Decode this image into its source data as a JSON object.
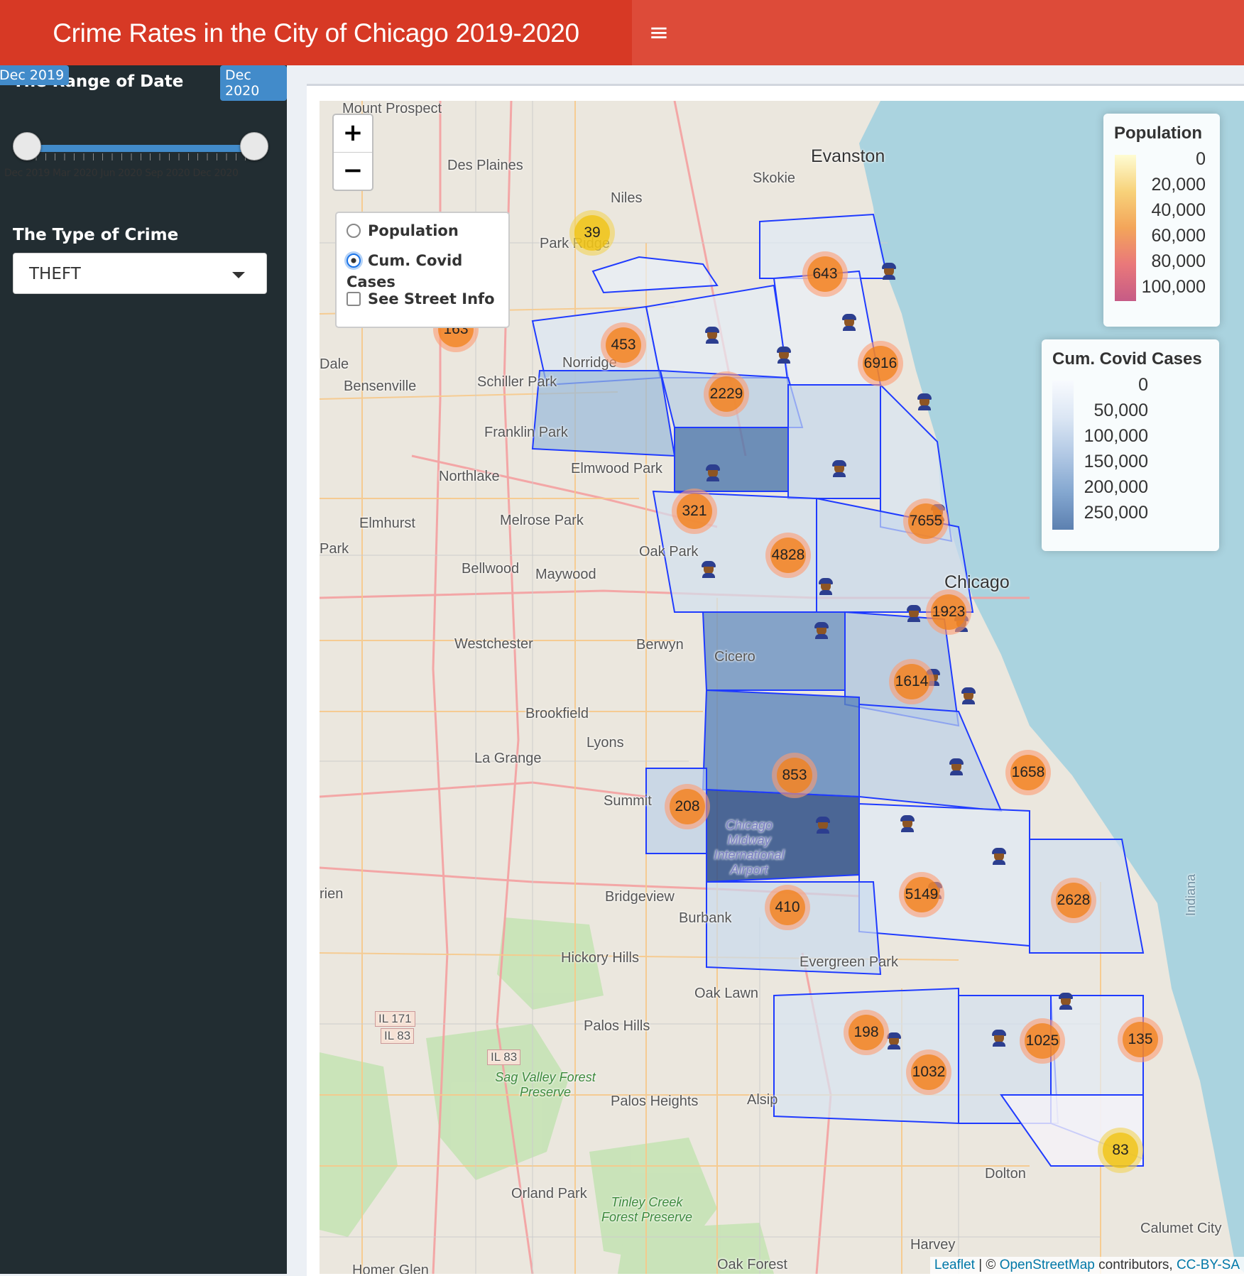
{
  "header": {
    "title": "Crime Rates in the City of Chicago 2019-2020",
    "menu_icon": "≡"
  },
  "sidebar": {
    "date_range": {
      "label": "The Range of Date",
      "from": "Dec 2019",
      "to": "Dec 2020",
      "tick_labels": "Dec 2019  Mar 2020  Jun 2020  Sep 2020  Dec 2020"
    },
    "crime_type": {
      "label": "The Type of Crime",
      "selected": "THEFT"
    }
  },
  "map": {
    "zoom_in": "+",
    "zoom_out": "−",
    "layers": {
      "population": "Population",
      "covid": "Cum. Covid Cases",
      "street": "See Street Info",
      "selected": "Cum. Covid Cases"
    },
    "legend_population": {
      "title": "Population",
      "ticks": [
        "0",
        "20,000",
        "40,000",
        "60,000",
        "80,000",
        "100,000"
      ]
    },
    "legend_covid": {
      "title": "Cum. Covid Cases",
      "ticks": [
        "0",
        "50,000",
        "100,000",
        "150,000",
        "200,000",
        "250,000"
      ]
    },
    "place_labels": {
      "mount_prospect": "Mount Prospect",
      "evanston": "Evanston",
      "skokie": "Skokie",
      "des_plaines": "Des Plaines",
      "niles": "Niles",
      "park_ridge": "Park Ridge",
      "norridge": "Norridge",
      "bensenville": "Bensenville",
      "schiller_park": "Schiller Park",
      "franklin_park": "Franklin Park",
      "elmwood_park": "Elmwood Park",
      "northlake": "Northlake",
      "elmhurst": "Elmhurst",
      "melrose_park": "Melrose Park",
      "oak_park": "Oak Park",
      "bellwood": "Bellwood",
      "maywood": "Maywood",
      "chicago": "Chicago",
      "westchester": "Westchester",
      "berwyn": "Berwyn",
      "cicero": "Cicero",
      "brookfield": "Brookfield",
      "lyons": "Lyons",
      "la_grange": "La Grange",
      "summit": "Summit",
      "bridgeview": "Bridgeview",
      "burbank": "Burbank",
      "hickory_hills": "Hickory Hills",
      "evergreen_park": "Evergreen Park",
      "oak_lawn": "Oak Lawn",
      "palos_hills": "Palos Hills",
      "palos_heights": "Palos Heights",
      "alsip": "Alsip",
      "orland_park": "Orland Park",
      "dolton": "Dolton",
      "harvey": "Harvey",
      "calumet_city": "Calumet City",
      "oak_forest": "Oak Forest",
      "homer_glen": "Homer Glen",
      "sag_valley": "Sag Valley Forest Preserve",
      "tinley_creek": "Tinley Creek Forest Preserve",
      "indiana": "Indiana",
      "midway": "Chicago Midway International Airport",
      "dale": "Dale",
      "park": "Park",
      "rien": "rien",
      "il171": "IL 171",
      "il83": "IL 83",
      "il83b": "IL 83"
    },
    "clusters": [
      {
        "label": "39",
        "color": "yellow"
      },
      {
        "label": "643",
        "color": "orange"
      },
      {
        "label": "163",
        "color": "orange"
      },
      {
        "label": "453",
        "color": "orange"
      },
      {
        "label": "6916",
        "color": "orange"
      },
      {
        "label": "2229",
        "color": "orange"
      },
      {
        "label": "321",
        "color": "orange"
      },
      {
        "label": "7655",
        "color": "orange"
      },
      {
        "label": "4828",
        "color": "orange"
      },
      {
        "label": "1923",
        "color": "orange"
      },
      {
        "label": "1614",
        "color": "orange"
      },
      {
        "label": "1658",
        "color": "orange"
      },
      {
        "label": "853",
        "color": "orange"
      },
      {
        "label": "208",
        "color": "orange"
      },
      {
        "label": "5149",
        "color": "orange"
      },
      {
        "label": "2628",
        "color": "orange"
      },
      {
        "label": "410",
        "color": "orange"
      },
      {
        "label": "198",
        "color": "orange"
      },
      {
        "label": "1025",
        "color": "orange"
      },
      {
        "label": "135",
        "color": "orange"
      },
      {
        "label": "1032",
        "color": "orange"
      },
      {
        "label": "83",
        "color": "yellow"
      }
    ],
    "attribution": {
      "leaflet": "Leaflet",
      "sep": " | © ",
      "osm": "OpenStreetMap",
      "contrib": " contributors, ",
      "license": "CC-BY-SA"
    }
  },
  "colors": {
    "header": "#dd4b39",
    "logo": "#d73925",
    "sidebar": "#222d32",
    "accent": "#428bca",
    "boundary": "#2233ee",
    "lake": "#aad3df"
  }
}
